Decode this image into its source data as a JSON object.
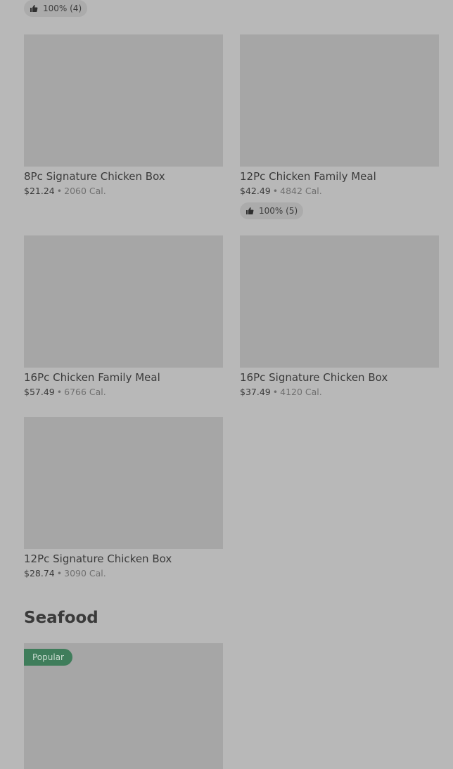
{
  "top_rating": {
    "text": "100% (4)"
  },
  "items": [
    {
      "title": "8Pc Signature Chicken Box",
      "price": "$21.24",
      "sep": "•",
      "calories": "2060 Cal."
    },
    {
      "title": "12Pc Chicken Family Meal",
      "price": "$42.49",
      "sep": "•",
      "calories": "4842 Cal.",
      "rating": "100% (5)"
    },
    {
      "title": "16Pc Chicken Family Meal",
      "price": "$57.49",
      "sep": "•",
      "calories": "6766 Cal."
    },
    {
      "title": "16Pc Signature Chicken Box",
      "price": "$37.49",
      "sep": "•",
      "calories": "4120 Cal."
    },
    {
      "title": "12Pc Signature Chicken Box",
      "price": "$28.74",
      "sep": "•",
      "calories": "3090 Cal."
    }
  ],
  "seafood": {
    "section_title": "Seafood",
    "first_item_badge": "Popular"
  },
  "icons": {
    "rating": "thumbs-up-icon"
  },
  "colors": {
    "background": "#b8b8b8",
    "image_placeholder": "#a6a6a6",
    "badge": "#3f7d5b"
  }
}
